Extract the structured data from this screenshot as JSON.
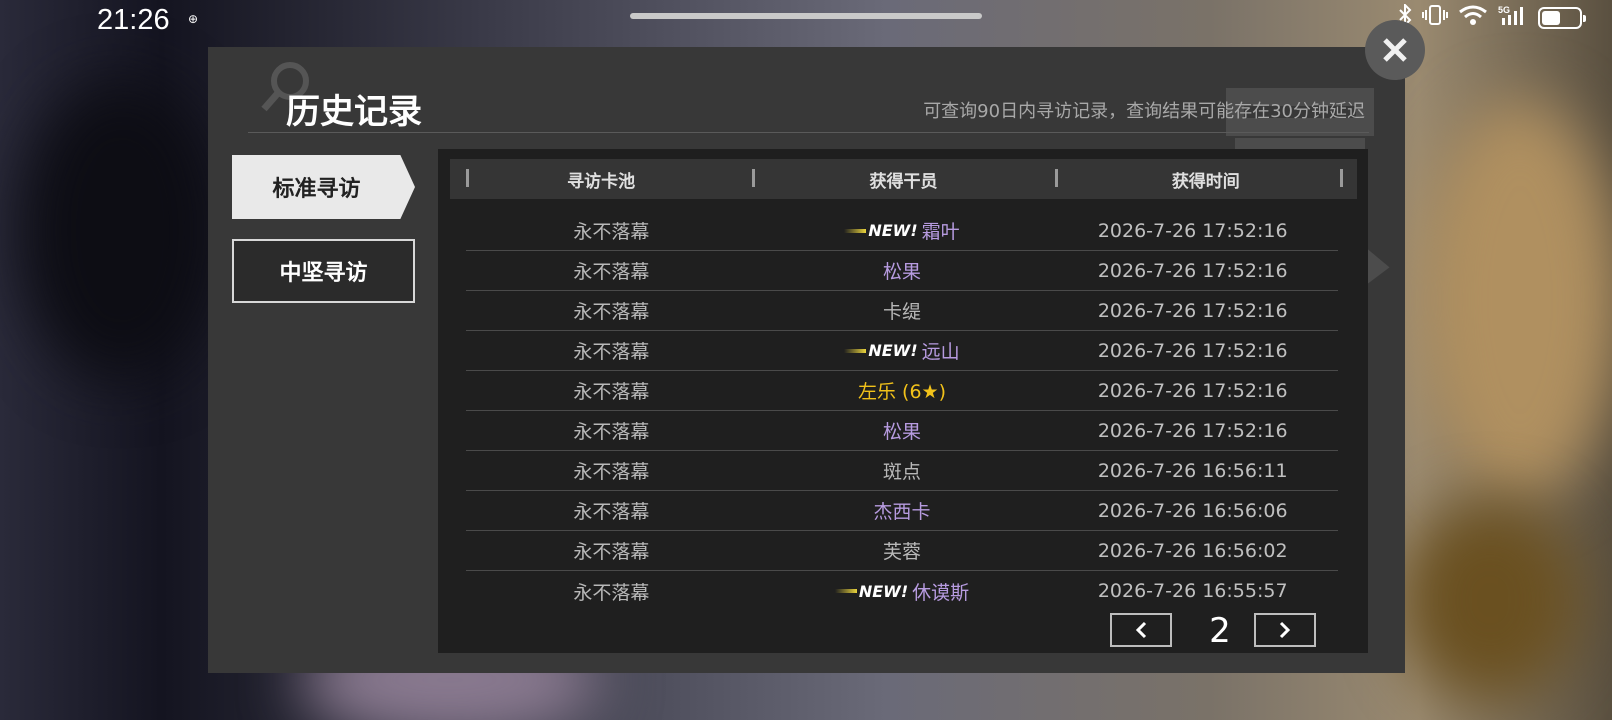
{
  "status_bar": {
    "time": "21:26",
    "extra_icon": "⊕"
  },
  "dialog": {
    "title": "历史记录",
    "subtitle": "可查询90日内寻访记录，查询结果可能存在30分钟延迟",
    "tabs": [
      {
        "label": "标准寻访",
        "active": true
      },
      {
        "label": "中坚寻访",
        "active": false
      }
    ],
    "table": {
      "headers": [
        "寻访卡池",
        "获得干员",
        "获得时间"
      ],
      "new_label": "NEW!",
      "rows": [
        {
          "pool": "永不落幕",
          "operator": "霜叶",
          "time": "2026-7-26 17:52:16",
          "is_new": true,
          "color": "#b79be0"
        },
        {
          "pool": "永不落幕",
          "operator": "松果",
          "time": "2026-7-26 17:52:16",
          "is_new": false,
          "color": "#b79be0"
        },
        {
          "pool": "永不落幕",
          "operator": "卡缇",
          "time": "2026-7-26 17:52:16",
          "is_new": false,
          "color": "#b8b8b8"
        },
        {
          "pool": "永不落幕",
          "operator": "远山",
          "time": "2026-7-26 17:52:16",
          "is_new": true,
          "color": "#b79be0"
        },
        {
          "pool": "永不落幕",
          "operator": "左乐 (6★)",
          "time": "2026-7-26 17:52:16",
          "is_new": false,
          "color": "#f2c21a"
        },
        {
          "pool": "永不落幕",
          "operator": "松果",
          "time": "2026-7-26 17:52:16",
          "is_new": false,
          "color": "#b79be0"
        },
        {
          "pool": "永不落幕",
          "operator": "斑点",
          "time": "2026-7-26 16:56:11",
          "is_new": false,
          "color": "#b8b8b8"
        },
        {
          "pool": "永不落幕",
          "operator": "杰西卡",
          "time": "2026-7-26 16:56:06",
          "is_new": false,
          "color": "#b79be0"
        },
        {
          "pool": "永不落幕",
          "operator": "芙蓉",
          "time": "2026-7-26 16:56:02",
          "is_new": false,
          "color": "#b8b8b8"
        },
        {
          "pool": "永不落幕",
          "operator": "休谟斯",
          "time": "2026-7-26 16:55:57",
          "is_new": true,
          "color": "#b79be0"
        }
      ]
    },
    "pagination": {
      "page": "2",
      "prev_icon": "chevron-left-icon",
      "next_icon": "chevron-right-icon"
    },
    "close_icon": "close-icon"
  }
}
